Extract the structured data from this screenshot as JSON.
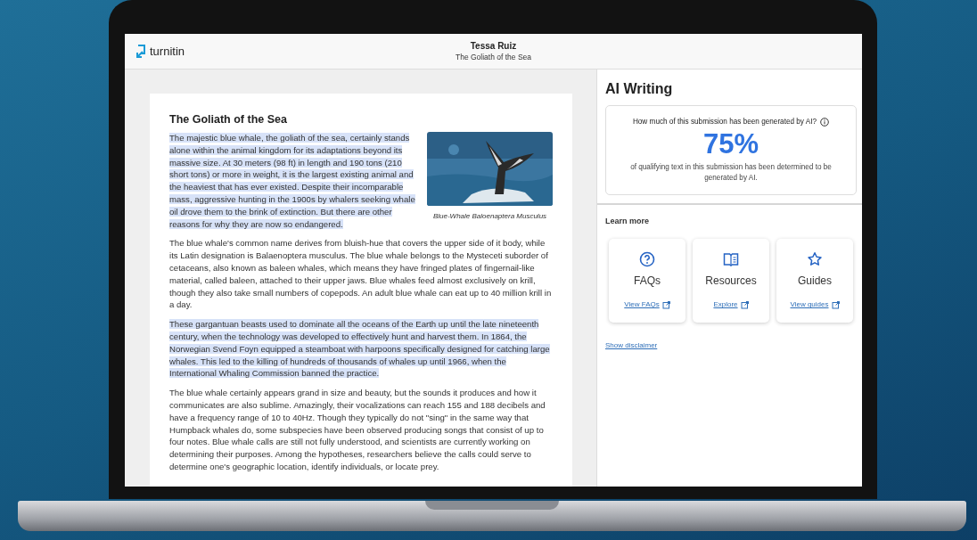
{
  "app": {
    "logo": "turnitin"
  },
  "header": {
    "student": "Tessa Ruiz",
    "submission_title": "The Goliath of the Sea"
  },
  "document": {
    "title": "The Goliath of the Sea",
    "image_caption": "Blue-Whale Baloenaptera Musculus",
    "paragraphs": [
      {
        "text": "The majestic blue whale, the goliath of the sea, certainly stands alone within the animal kingdom for its adaptations beyond its massive size. At 30 meters (98 ft) in length and 190 tons (210 short tons) or more in weight, it is the largest existing animal and the heaviest that has ever existed. Despite their incomparable mass, aggressive hunting in the 1900s by whalers seeking whale oil drove them to the brink of extinction. But there are other reasons for why they are now so endangered.",
        "highlighted": true
      },
      {
        "text": "The blue whale's common name derives from bluish-hue that covers the upper side of it body, while its Latin designation is Balaenoptera musculus. The blue whale belongs to the Mysteceti suborder of cetaceans, also known as baleen whales, which means they have fringed plates of fingernail-like material, called baleen, attached to their upper jaws. Blue whales feed almost exclusively on krill, though they also take small numbers of copepods. An adult blue whale can eat up to 40 million krill in a day.",
        "highlighted": false
      },
      {
        "text": "These gargantuan beasts used to dominate all the oceans of the Earth up until the late nineteenth century, when the technology was developed to effectively hunt and harvest them. In 1864, the Norwegian Svend Foyn equipped a steamboat with harpoons specifically designed for catching large whales. This led to the killing of hundreds of thousands of whales up until 1966, when the International Whaling Commission banned the practice.",
        "highlighted": true
      },
      {
        "text": "The blue whale certainly appears grand in size and beauty, but the sounds it produces and how it communicates are also sublime. Amazingly, their vocalizations can reach 155 and 188 decibels and have a frequency range of 10 to 40Hz. Though they typically do not \"sing\" in the same way that Humpback whales do, some subspecies have been observed producing songs that consist of up to four notes. Blue whale calls are still not fully understood, and scientists are currently working on determining their purposes. Among the hypotheses, researchers believe the calls could serve to determine one's geographic location, identify individuals, or locate prey.",
        "highlighted": false
      }
    ]
  },
  "ai_panel": {
    "title": "AI Writing",
    "question": "How much of this submission has been generated by AI?",
    "percentage": "75%",
    "description": "of qualifying text in this submission has been determined to be generated by AI."
  },
  "learn_more": {
    "heading": "Learn more",
    "cards": [
      {
        "kind": "faq",
        "title": "FAQs",
        "link": "View FAQs"
      },
      {
        "kind": "resources",
        "title": "Resources",
        "link": "Explore"
      },
      {
        "kind": "guides",
        "title": "Guides",
        "link": "View guides"
      }
    ]
  },
  "disclaimer_link": "Show disclaimer"
}
